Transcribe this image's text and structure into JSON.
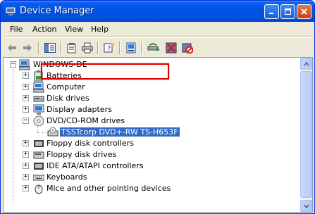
{
  "window": {
    "title": "Device Manager",
    "controls": [
      "minimize-icon",
      "maximize-icon",
      "close-icon"
    ]
  },
  "menu": {
    "file": "File",
    "action": "Action",
    "view": "View",
    "help": "Help"
  },
  "toolbar": {
    "buttons": [
      "back-icon",
      "forward-icon",
      "show-hide-tree-icon",
      "properties-icon",
      "print-icon",
      "help-icon",
      "scan-hardware-icon",
      "update-driver-icon",
      "uninstall-icon",
      "disable-icon"
    ]
  },
  "tree": {
    "root": "WINDOWS-DE",
    "items": [
      {
        "label": "Batteries",
        "icon": "battery-icon",
        "expanded": false
      },
      {
        "label": "Computer",
        "icon": "computer-icon",
        "expanded": false
      },
      {
        "label": "Disk drives",
        "icon": "disk-drive-icon",
        "expanded": false
      },
      {
        "label": "Display adapters",
        "icon": "display-adapter-icon",
        "expanded": false
      },
      {
        "label": "DVD/CD-ROM drives",
        "icon": "dvd-drive-icon",
        "expanded": true
      },
      {
        "label": "Floppy disk controllers",
        "icon": "controller-icon",
        "expanded": false
      },
      {
        "label": "Floppy disk drives",
        "icon": "floppy-icon",
        "expanded": false
      },
      {
        "label": "IDE ATA/ATAPI controllers",
        "icon": "controller-icon",
        "expanded": false
      },
      {
        "label": "Keyboards",
        "icon": "keyboard-icon",
        "expanded": false
      },
      {
        "label": "Mice and other pointing devices",
        "icon": "mouse-icon",
        "expanded": false
      }
    ],
    "child": {
      "label": "TSSTcorp DVD+-RW TS-H653F",
      "icon": "dvd-drive-icon",
      "selected": true
    }
  },
  "colors": {
    "selection": "#316ac5",
    "highlight_box": "#e00000",
    "titlebar": "#0054e3"
  }
}
